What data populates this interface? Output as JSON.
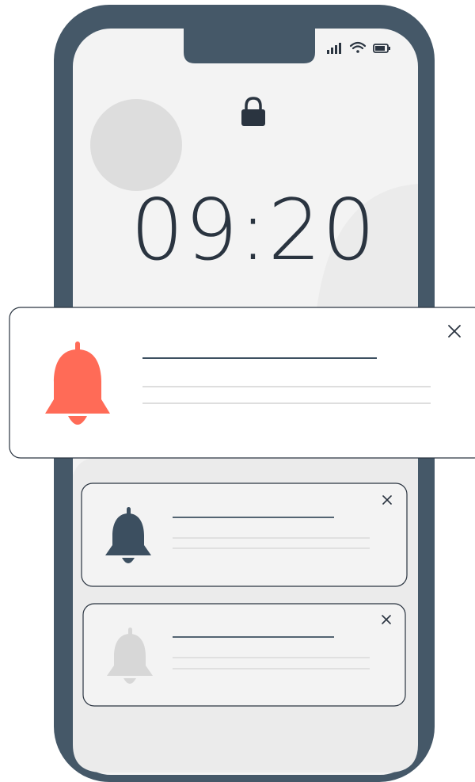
{
  "lock_screen": {
    "time": "09:20"
  },
  "status_bar": {
    "icons": [
      "signal-icon",
      "wifi-icon",
      "battery-icon"
    ]
  },
  "notifications": [
    {
      "icon": "bell-icon",
      "state": "active",
      "bell_color": "#ff6b57",
      "close_icon": "close-icon"
    },
    {
      "icon": "bell-icon",
      "state": "normal",
      "bell_color": "#3c4f60",
      "close_icon": "close-icon"
    },
    {
      "icon": "bell-icon",
      "state": "faded",
      "bell_color": "#d7d7d7",
      "close_icon": "close-icon"
    }
  ],
  "colors": {
    "phone_frame": "#455868",
    "screen": "#f3f3f3",
    "accent_bell": "#ff6b57",
    "dark_bell": "#3c4f60",
    "muted_bell": "#d7d7d7",
    "text_dark": "#2a3440"
  }
}
